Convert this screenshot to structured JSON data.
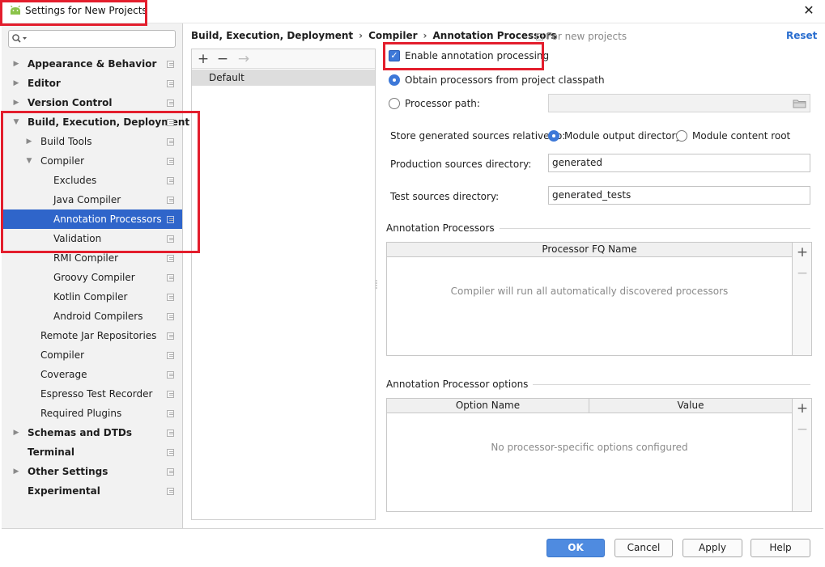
{
  "window": {
    "title": "Settings for New Projects",
    "close_glyph": "✕"
  },
  "search": {
    "placeholder": "",
    "icon": "search-icon"
  },
  "tree": [
    {
      "label": "Appearance & Behavior",
      "bold": true,
      "expander": "collapsed"
    },
    {
      "label": "Editor",
      "bold": true,
      "expander": "collapsed"
    },
    {
      "label": "Version Control",
      "bold": true,
      "expander": "collapsed"
    },
    {
      "label": "Build, Execution, Deployment",
      "bold": true,
      "expander": "expanded"
    },
    {
      "label": "Build Tools",
      "bold": false,
      "expander": "collapsed"
    },
    {
      "label": "Compiler",
      "bold": false,
      "expander": "expanded"
    },
    {
      "label": "Excludes",
      "bold": false,
      "expander": "none"
    },
    {
      "label": "Java Compiler",
      "bold": false,
      "expander": "none"
    },
    {
      "label": "Annotation Processors",
      "bold": false,
      "expander": "none",
      "selected": true
    },
    {
      "label": "Validation",
      "bold": false,
      "expander": "none"
    },
    {
      "label": "RMI Compiler",
      "bold": false,
      "expander": "none"
    },
    {
      "label": "Groovy Compiler",
      "bold": false,
      "expander": "none"
    },
    {
      "label": "Kotlin Compiler",
      "bold": false,
      "expander": "none"
    },
    {
      "label": "Android Compilers",
      "bold": false,
      "expander": "none"
    },
    {
      "label": "Remote Jar Repositories",
      "bold": false,
      "expander": "none"
    },
    {
      "label": "Compiler",
      "bold": false,
      "expander": "none"
    },
    {
      "label": "Coverage",
      "bold": false,
      "expander": "none"
    },
    {
      "label": "Espresso Test Recorder",
      "bold": false,
      "expander": "none"
    },
    {
      "label": "Required Plugins",
      "bold": false,
      "expander": "none"
    },
    {
      "label": "Schemas and DTDs",
      "bold": true,
      "expander": "collapsed"
    },
    {
      "label": "Terminal",
      "bold": true,
      "expander": "none"
    },
    {
      "label": "Other Settings",
      "bold": true,
      "expander": "collapsed"
    },
    {
      "label": "Experimental",
      "bold": true,
      "expander": "none"
    }
  ],
  "profiles": {
    "add_glyph": "+",
    "remove_glyph": "−",
    "move_glyph": "→",
    "items": [
      "Default"
    ]
  },
  "breadcrumb": {
    "items": [
      "Build, Execution, Deployment",
      "Compiler",
      "Annotation Processors"
    ],
    "separator": "›",
    "scope": "For new projects",
    "reset": "Reset"
  },
  "settings": {
    "enable_label": "Enable annotation processing",
    "enable_checked": true,
    "obtain_label": "Obtain processors from project classpath",
    "obtain_selected": true,
    "processor_path_label": "Processor path:",
    "processor_path_value": "",
    "store_label": "Store generated sources relative to:",
    "module_output_label": "Module output directory",
    "module_output_selected": true,
    "module_content_label": "Module content root",
    "production_label": "Production sources directory:",
    "production_value": "generated",
    "test_label": "Test sources directory:",
    "test_value": "generated_tests"
  },
  "processors_section": {
    "title": "Annotation Processors",
    "column": "Processor FQ Name",
    "empty": "Compiler will run all automatically discovered processors"
  },
  "options_section": {
    "title": "Annotation Processor options",
    "columns": [
      "Option Name",
      "Value"
    ],
    "empty": "No processor-specific options configured"
  },
  "buttons": {
    "ok": "OK",
    "cancel": "Cancel",
    "apply": "Apply",
    "help": "Help"
  },
  "side_tools": {
    "add": "+",
    "remove": "−"
  },
  "colors": {
    "accent": "#2f65ca",
    "highlight": "#e31e2d",
    "link": "#2a6ecf"
  }
}
